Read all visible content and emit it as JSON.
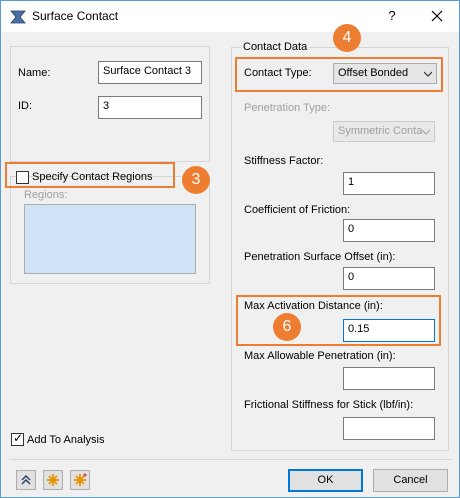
{
  "window": {
    "title": "Surface Contact",
    "help_label": "?"
  },
  "left": {
    "name_label": "Name:",
    "name_value": "Surface Contact 3",
    "id_label": "ID:",
    "id_value": "3",
    "specify_regions_label": "Specify Contact Regions",
    "specify_regions_checked": false,
    "regions_label": "Regions:",
    "add_to_analysis_label": "Add To Analysis",
    "add_to_analysis_checked": true
  },
  "contact_data": {
    "group_title": "Contact Data",
    "contact_type_label": "Contact Type:",
    "contact_type_value": "Offset Bonded",
    "penetration_type_label": "Penetration Type:",
    "penetration_type_value": "Symmetric Conta",
    "stiffness_factor_label": "Stiffness Factor:",
    "stiffness_factor_value": "1",
    "coefficient_friction_label": "Coefficient of Friction:",
    "coefficient_friction_value": "0",
    "penetration_offset_label": "Penetration Surface Offset (in):",
    "penetration_offset_value": "0",
    "max_activation_label": "Max Activation Distance (in):",
    "max_activation_value": "0.15",
    "max_penetration_label": "Max Allowable Penetration (in):",
    "max_penetration_value": "",
    "frictional_stiffness_label": "Frictional Stiffness for Stick (lbf/in):",
    "frictional_stiffness_value": ""
  },
  "callouts": {
    "badge_3": "3",
    "badge_4": "4",
    "badge_6": "6"
  },
  "footer": {
    "ok_label": "OK",
    "cancel_label": "Cancel"
  },
  "icons": {
    "app": "surface-contact-icon",
    "collapse": "double-chevron-up-icon",
    "star1": "asterisk-icon",
    "star2": "asterisk-grid-icon"
  },
  "colors": {
    "callout": "#ed7d31",
    "regions_bg": "#cfe3f7",
    "accent": "#0078d7"
  }
}
